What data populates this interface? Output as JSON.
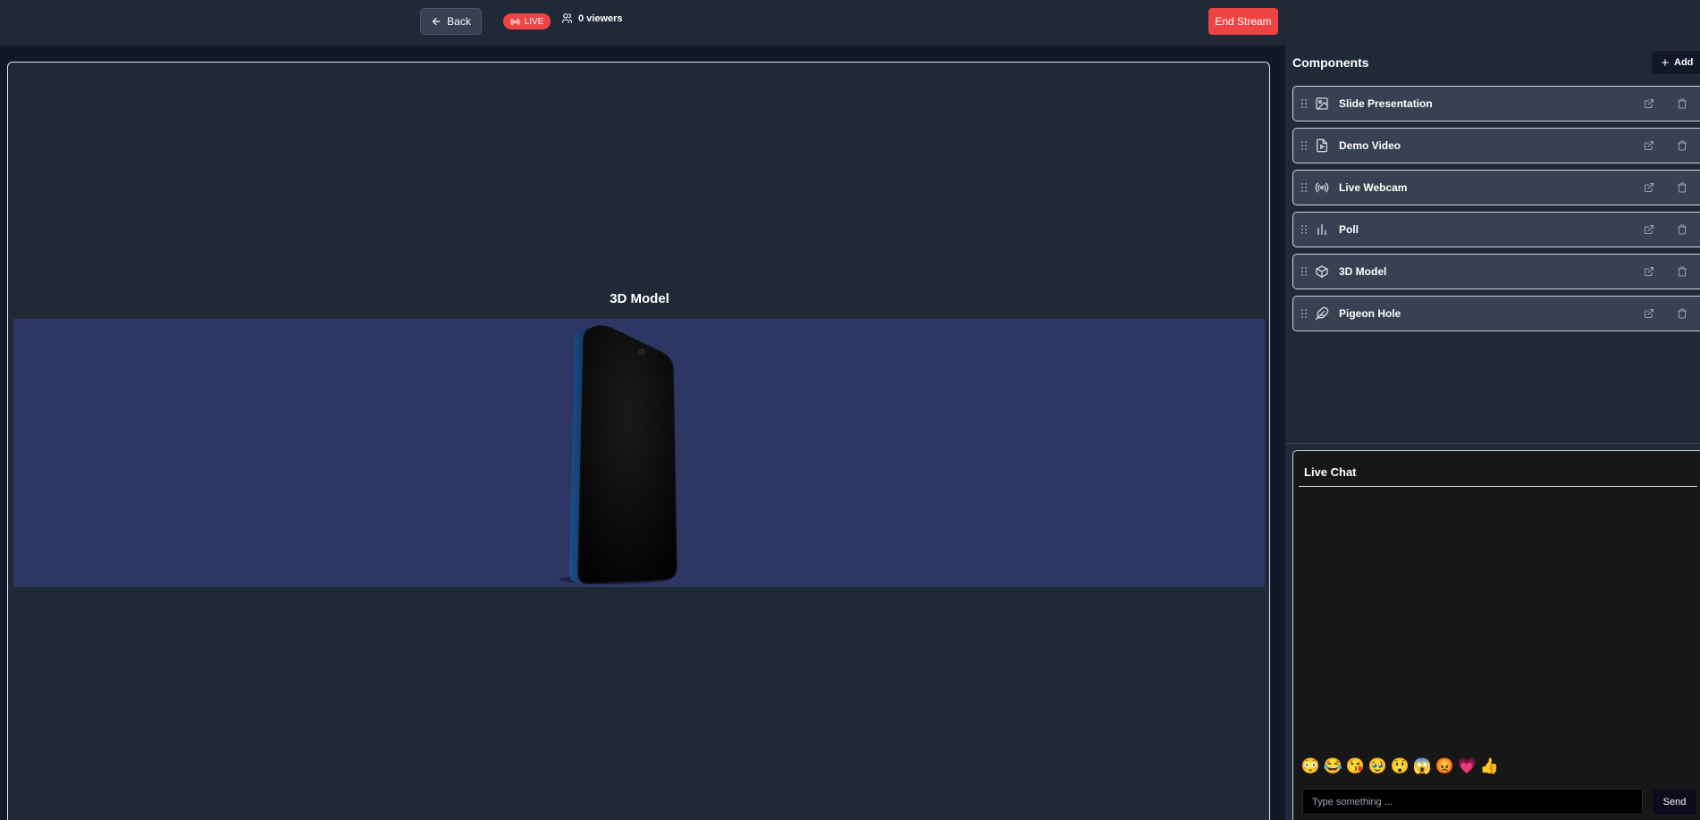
{
  "header": {
    "back_label": "Back",
    "live_label": "LIVE",
    "viewers_label": "0 viewers",
    "end_stream_label": "End Stream"
  },
  "stage": {
    "title": "3D Model"
  },
  "components": {
    "title": "Components",
    "add_label": "Add",
    "items": [
      {
        "label": "Slide Presentation",
        "icon": "image-icon"
      },
      {
        "label": "Demo Video",
        "icon": "video-file-icon"
      },
      {
        "label": "Live Webcam",
        "icon": "broadcast-icon"
      },
      {
        "label": "Poll",
        "icon": "bar-chart-icon"
      },
      {
        "label": "3D Model",
        "icon": "cube-icon"
      },
      {
        "label": "Pigeon Hole",
        "icon": "feather-icon"
      }
    ]
  },
  "chat": {
    "title": "Live Chat",
    "emojis": [
      "😳",
      "😂",
      "😘",
      "🥹",
      "😲",
      "😱",
      "😡",
      "💗",
      "👍"
    ],
    "input_placeholder": "Type something ...",
    "send_label": "Send"
  },
  "colors": {
    "accent_red": "#ef4444",
    "background": "#1f2937",
    "model_background": "#2e3763"
  }
}
